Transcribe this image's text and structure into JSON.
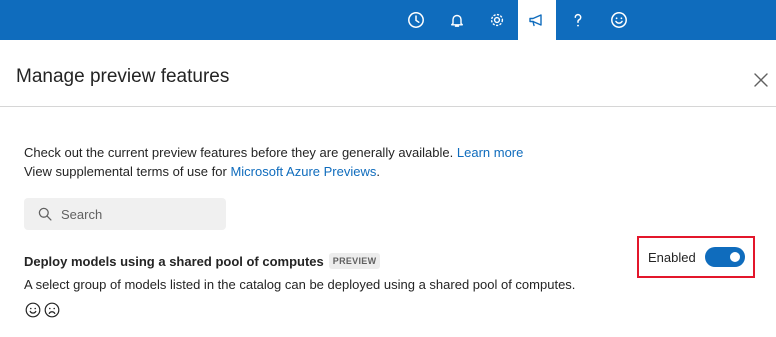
{
  "topbar": {
    "icons": [
      "history-icon",
      "bell-icon",
      "gear-icon",
      "megaphone-icon",
      "help-icon",
      "smiley-icon"
    ],
    "active": "megaphone-icon",
    "brand_color": "#0f6cbd"
  },
  "panel": {
    "title": "Manage preview features",
    "close_icon": "close-icon"
  },
  "intro": {
    "line1_text": "Check out the current preview features before they are generally available.",
    "line1_link": "Learn more",
    "line2_text": "View supplemental terms of use for",
    "line2_link": "Microsoft Azure Previews",
    "line2_end": "."
  },
  "search": {
    "placeholder": "Search",
    "value": ""
  },
  "features": [
    {
      "title": "Deploy models using a shared pool of computes",
      "badge": "PREVIEW",
      "description": "A select group of models listed in the catalog can be deployed using a shared pool of computes.",
      "feedback_icons": [
        "smile-icon",
        "frown-icon"
      ],
      "status_label": "Enabled",
      "enabled": true
    }
  ],
  "colors": {
    "accent": "#0f6cbd",
    "highlight_border": "#e3162b"
  }
}
